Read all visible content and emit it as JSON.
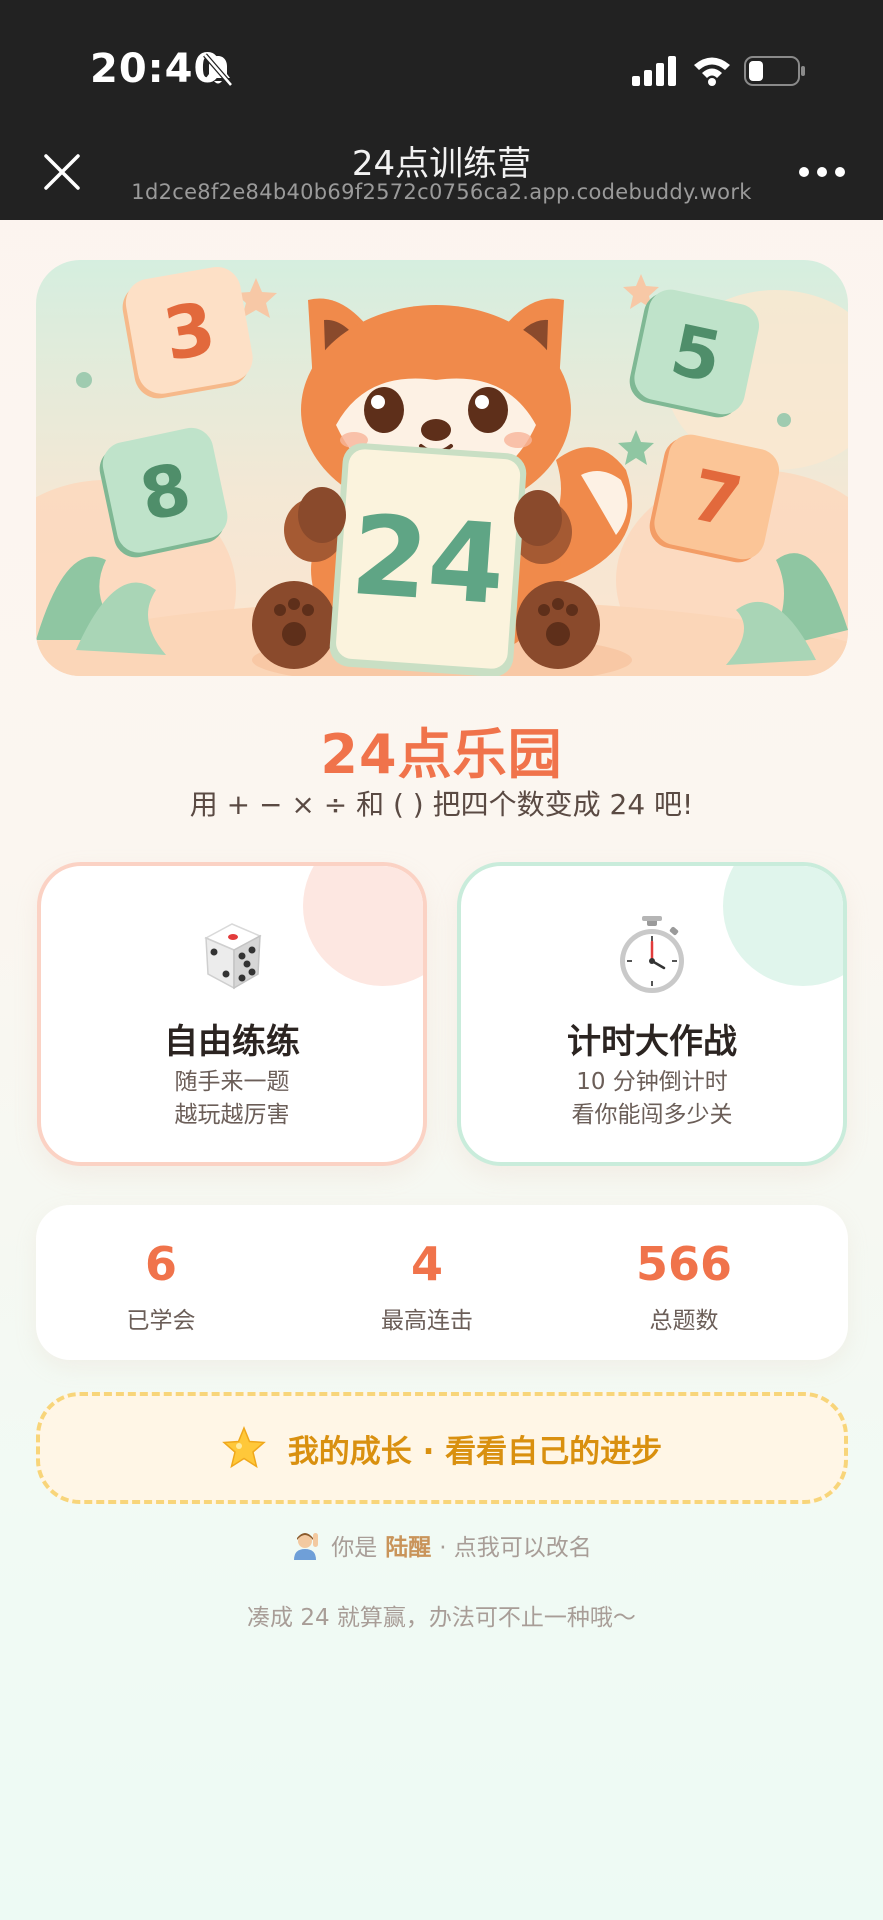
{
  "status_bar": {
    "time": "20:40"
  },
  "nav": {
    "title": "24点训练营",
    "url": "1d2ce8f2e84b40b69f2572c0756ca2.app.codebuddy.work"
  },
  "hero": {
    "card_number": "24",
    "tiles": [
      "3",
      "5",
      "8",
      "7"
    ]
  },
  "header": {
    "title": "24点乐园",
    "subtitle": "用 + − × ÷ 和 ( ) 把四个数变成 24 吧!"
  },
  "modes": [
    {
      "icon": "dice-icon",
      "title": "自由练练",
      "line1": "随手来一题",
      "line2": "越玩越厉害"
    },
    {
      "icon": "stopwatch-icon",
      "title": "计时大作战",
      "line1": "10 分钟倒计时",
      "line2": "看你能闯多少关"
    }
  ],
  "stats": [
    {
      "value": "6",
      "label": "已学会"
    },
    {
      "value": "4",
      "label": "最高连击"
    },
    {
      "value": "566",
      "label": "总题数"
    }
  ],
  "growth": {
    "label": "我的成长 · 看看自己的进步"
  },
  "user": {
    "prefix": "你是",
    "name": "陆醒",
    "suffix": "· 点我可以改名"
  },
  "tip": "凑成 24 就算赢，办法可不止一种哦～",
  "colors": {
    "accent": "#f0734b",
    "gold": "#d9900f",
    "mint": "#5fa585"
  }
}
